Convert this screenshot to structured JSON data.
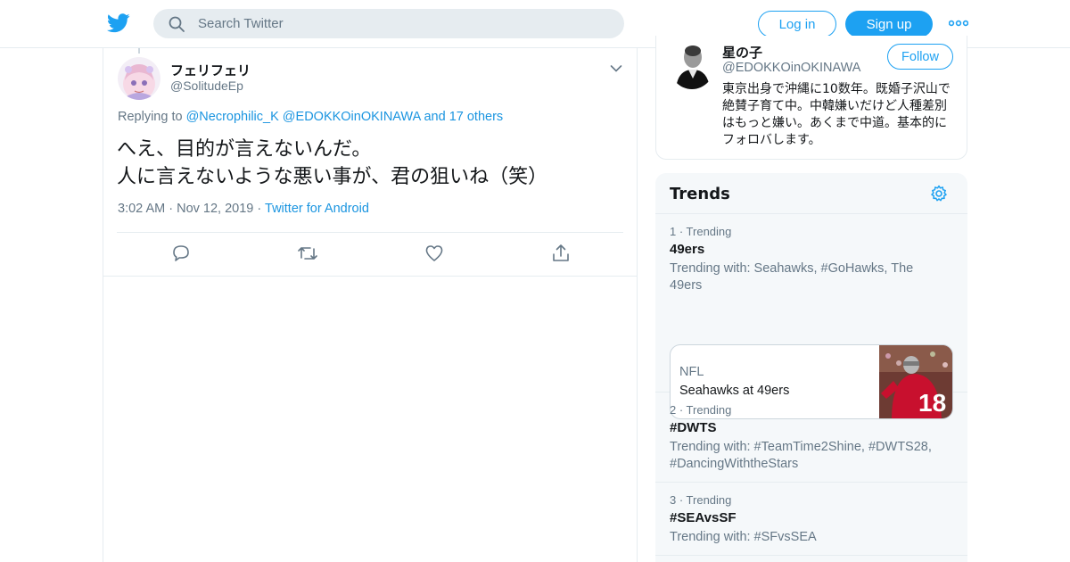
{
  "header": {
    "search_placeholder": "Search Twitter",
    "login_label": "Log in",
    "signup_label": "Sign up",
    "brand_color": "#1da1f2"
  },
  "tweet": {
    "display_name": "フェリフェリ",
    "handle": "@SolitudeEp",
    "replying_prefix": "Replying to",
    "replying_user1": "@Necrophilic_K",
    "replying_user2": "@EDOKKOinOKINAWA",
    "replying_others": "and 17 others",
    "text": "へえ、目的が言えないんだ。\n人に言えないような悪い事が、君の狙いね（笑）",
    "time": "3:02 AM",
    "date": "Nov 12, 2019",
    "sep": "·",
    "source": "Twitter for Android",
    "actions": [
      "reply-icon",
      "retweet-icon",
      "like-icon",
      "share-icon"
    ]
  },
  "profile_card": {
    "display_name": "星の子",
    "handle": "@EDOKKOinOKINAWA",
    "follow_label": "Follow",
    "bio": "東京出身で沖縄に10数年。既婚子沢山で絶賛子育て中。中韓嫌いだけど人種差別はもっと嫌い。あくまで中道。基本的にフォロバします。"
  },
  "trends": {
    "title": "Trends",
    "items": [
      {
        "rank": "1 · Trending",
        "name": "49ers",
        "with": "Trending with: Seahawks, #GoHawks, The 49ers",
        "card": {
          "category": "NFL",
          "headline": "Seahawks at 49ers",
          "jersey_number": "18"
        }
      },
      {
        "rank": "2 · Trending",
        "name": "#DWTS",
        "with": "Trending with: #TeamTime2Shine, #DWTS28, #DancingWiththeStars"
      },
      {
        "rank": "3 · Trending",
        "name": "#SEAvsSF",
        "with": "Trending with: #SFvsSEA"
      }
    ]
  }
}
